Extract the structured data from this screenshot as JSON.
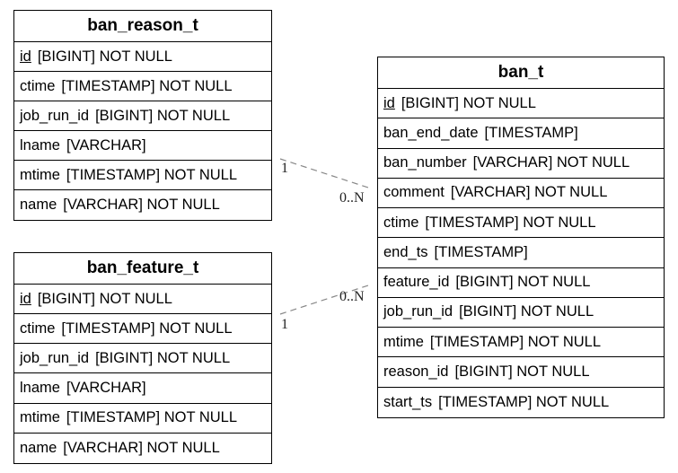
{
  "tables": [
    {
      "name": "ban_reason_t",
      "columns": [
        {
          "name": "id",
          "type": "[BIGINT] NOT NULL",
          "pk": true
        },
        {
          "name": "ctime",
          "type": "[TIMESTAMP] NOT NULL"
        },
        {
          "name": "job_run_id",
          "type": "[BIGINT] NOT NULL"
        },
        {
          "name": "lname",
          "type": "[VARCHAR]"
        },
        {
          "name": "mtime",
          "type": "[TIMESTAMP] NOT NULL"
        },
        {
          "name": "name",
          "type": "[VARCHAR] NOT NULL"
        }
      ]
    },
    {
      "name": "ban_feature_t",
      "columns": [
        {
          "name": "id",
          "type": "[BIGINT] NOT NULL",
          "pk": true
        },
        {
          "name": "ctime",
          "type": "[TIMESTAMP] NOT NULL"
        },
        {
          "name": "job_run_id",
          "type": "[BIGINT] NOT NULL"
        },
        {
          "name": "lname",
          "type": "[VARCHAR]"
        },
        {
          "name": "mtime",
          "type": "[TIMESTAMP] NOT NULL"
        },
        {
          "name": "name",
          "type": "[VARCHAR] NOT NULL"
        }
      ]
    },
    {
      "name": "ban_t",
      "columns": [
        {
          "name": "id",
          "type": "[BIGINT] NOT NULL",
          "pk": true
        },
        {
          "name": "ban_end_date",
          "type": "[TIMESTAMP]"
        },
        {
          "name": "ban_number",
          "type": "[VARCHAR] NOT NULL"
        },
        {
          "name": "comment",
          "type": "[VARCHAR] NOT NULL"
        },
        {
          "name": "ctime",
          "type": "[TIMESTAMP] NOT NULL"
        },
        {
          "name": "end_ts",
          "type": "[TIMESTAMP]"
        },
        {
          "name": "feature_id",
          "type": "[BIGINT] NOT NULL"
        },
        {
          "name": "job_run_id",
          "type": "[BIGINT] NOT NULL"
        },
        {
          "name": "mtime",
          "type": "[TIMESTAMP] NOT NULL"
        },
        {
          "name": "reason_id",
          "type": "[BIGINT] NOT NULL"
        },
        {
          "name": "start_ts",
          "type": "[TIMESTAMP] NOT NULL"
        }
      ]
    }
  ],
  "relationships": [
    {
      "from": "ban_reason_t",
      "to": "ban_t",
      "from_label": "1",
      "to_label": "0..N"
    },
    {
      "from": "ban_feature_t",
      "to": "ban_t",
      "from_label": "1",
      "to_label": "0..N"
    }
  ],
  "edge_color": "#888888"
}
